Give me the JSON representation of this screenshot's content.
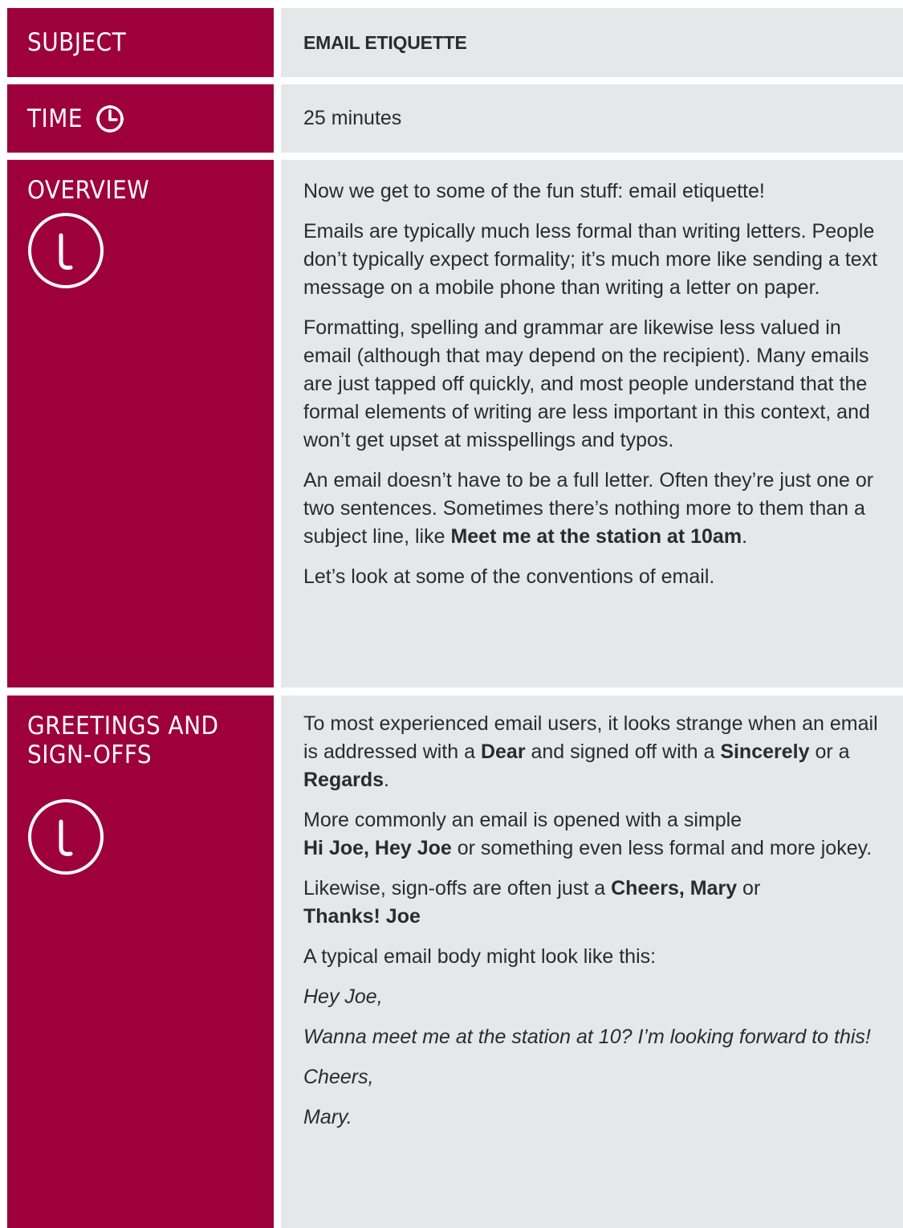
{
  "subject": {
    "label": "SUBJECT",
    "value": "EMAIL ETIQUETTE"
  },
  "time": {
    "label": "TIME",
    "icon": "clock-icon",
    "value": "25 minutes"
  },
  "overview": {
    "label": "OVERVIEW",
    "icon": "info-icon",
    "paragraphs": [
      "Now we get to some of the fun stuff: email etiquette!",
      "Emails are typically much less formal than writing letters. People don’t typically expect formality; it’s much more like sending a text message on a mobile phone than writing a letter on paper.",
      "Formatting, spelling and grammar are likewise less valued in email (although that may depend on the recipient). Many emails are just tapped off quickly, and most people understand that the formal elements of writing are less important in this context, and won’t get upset at misspellings and typos.",
      "An email doesn’t have to be a full letter. Often they’re just one or two sentences. Sometimes there’s nothing more to them than a subject line, like ",
      "Let’s look at some of the conventions of email."
    ],
    "example_subject": "Meet me at the station at 10am",
    "example_end": "."
  },
  "greetings": {
    "label": "GREETINGS AND SIGN-OFFS",
    "icon": "info-icon",
    "p1": {
      "a": "To most experienced email users, it looks strange when an email is addressed with a ",
      "dear": "Dear",
      "b": " and signed off with a ",
      "sincerely": "Sincerely",
      "c": " or a ",
      "regards": "Regards",
      "d": "."
    },
    "p2": {
      "a": "More commonly an email is opened with a simple ",
      "hi": "Hi Joe, Hey Joe",
      "b": " or something even less formal and more jokey."
    },
    "p3": {
      "a": "Likewise, sign-offs are often just a ",
      "cheers": "Cheers, Mary",
      "b": " or ",
      "thanks": "Thanks! Joe"
    },
    "p4": "A typical email body might look like this:",
    "example": [
      "Hey Joe,",
      "Wanna meet me at the station at 10? I’m looking forward to this!",
      "Cheers,",
      "Mary."
    ]
  },
  "colors": {
    "label_bg": "#9e003b",
    "content_bg": "#e6e7e9"
  }
}
